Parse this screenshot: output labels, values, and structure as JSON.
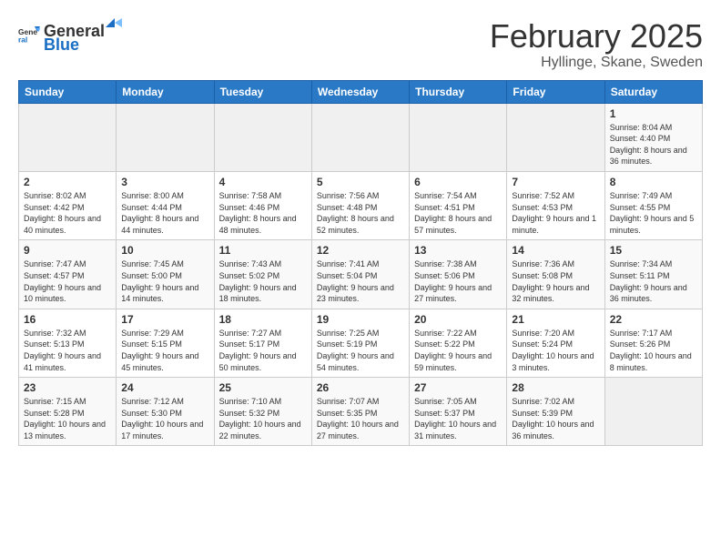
{
  "header": {
    "logo_general": "General",
    "logo_blue": "Blue",
    "month_title": "February 2025",
    "location": "Hyllinge, Skane, Sweden"
  },
  "weekdays": [
    "Sunday",
    "Monday",
    "Tuesday",
    "Wednesday",
    "Thursday",
    "Friday",
    "Saturday"
  ],
  "weeks": [
    [
      {
        "day": "",
        "info": ""
      },
      {
        "day": "",
        "info": ""
      },
      {
        "day": "",
        "info": ""
      },
      {
        "day": "",
        "info": ""
      },
      {
        "day": "",
        "info": ""
      },
      {
        "day": "",
        "info": ""
      },
      {
        "day": "1",
        "info": "Sunrise: 8:04 AM\nSunset: 4:40 PM\nDaylight: 8 hours and 36 minutes."
      }
    ],
    [
      {
        "day": "2",
        "info": "Sunrise: 8:02 AM\nSunset: 4:42 PM\nDaylight: 8 hours and 40 minutes."
      },
      {
        "day": "3",
        "info": "Sunrise: 8:00 AM\nSunset: 4:44 PM\nDaylight: 8 hours and 44 minutes."
      },
      {
        "day": "4",
        "info": "Sunrise: 7:58 AM\nSunset: 4:46 PM\nDaylight: 8 hours and 48 minutes."
      },
      {
        "day": "5",
        "info": "Sunrise: 7:56 AM\nSunset: 4:48 PM\nDaylight: 8 hours and 52 minutes."
      },
      {
        "day": "6",
        "info": "Sunrise: 7:54 AM\nSunset: 4:51 PM\nDaylight: 8 hours and 57 minutes."
      },
      {
        "day": "7",
        "info": "Sunrise: 7:52 AM\nSunset: 4:53 PM\nDaylight: 9 hours and 1 minute."
      },
      {
        "day": "8",
        "info": "Sunrise: 7:49 AM\nSunset: 4:55 PM\nDaylight: 9 hours and 5 minutes."
      }
    ],
    [
      {
        "day": "9",
        "info": "Sunrise: 7:47 AM\nSunset: 4:57 PM\nDaylight: 9 hours and 10 minutes."
      },
      {
        "day": "10",
        "info": "Sunrise: 7:45 AM\nSunset: 5:00 PM\nDaylight: 9 hours and 14 minutes."
      },
      {
        "day": "11",
        "info": "Sunrise: 7:43 AM\nSunset: 5:02 PM\nDaylight: 9 hours and 18 minutes."
      },
      {
        "day": "12",
        "info": "Sunrise: 7:41 AM\nSunset: 5:04 PM\nDaylight: 9 hours and 23 minutes."
      },
      {
        "day": "13",
        "info": "Sunrise: 7:38 AM\nSunset: 5:06 PM\nDaylight: 9 hours and 27 minutes."
      },
      {
        "day": "14",
        "info": "Sunrise: 7:36 AM\nSunset: 5:08 PM\nDaylight: 9 hours and 32 minutes."
      },
      {
        "day": "15",
        "info": "Sunrise: 7:34 AM\nSunset: 5:11 PM\nDaylight: 9 hours and 36 minutes."
      }
    ],
    [
      {
        "day": "16",
        "info": "Sunrise: 7:32 AM\nSunset: 5:13 PM\nDaylight: 9 hours and 41 minutes."
      },
      {
        "day": "17",
        "info": "Sunrise: 7:29 AM\nSunset: 5:15 PM\nDaylight: 9 hours and 45 minutes."
      },
      {
        "day": "18",
        "info": "Sunrise: 7:27 AM\nSunset: 5:17 PM\nDaylight: 9 hours and 50 minutes."
      },
      {
        "day": "19",
        "info": "Sunrise: 7:25 AM\nSunset: 5:19 PM\nDaylight: 9 hours and 54 minutes."
      },
      {
        "day": "20",
        "info": "Sunrise: 7:22 AM\nSunset: 5:22 PM\nDaylight: 9 hours and 59 minutes."
      },
      {
        "day": "21",
        "info": "Sunrise: 7:20 AM\nSunset: 5:24 PM\nDaylight: 10 hours and 3 minutes."
      },
      {
        "day": "22",
        "info": "Sunrise: 7:17 AM\nSunset: 5:26 PM\nDaylight: 10 hours and 8 minutes."
      }
    ],
    [
      {
        "day": "23",
        "info": "Sunrise: 7:15 AM\nSunset: 5:28 PM\nDaylight: 10 hours and 13 minutes."
      },
      {
        "day": "24",
        "info": "Sunrise: 7:12 AM\nSunset: 5:30 PM\nDaylight: 10 hours and 17 minutes."
      },
      {
        "day": "25",
        "info": "Sunrise: 7:10 AM\nSunset: 5:32 PM\nDaylight: 10 hours and 22 minutes."
      },
      {
        "day": "26",
        "info": "Sunrise: 7:07 AM\nSunset: 5:35 PM\nDaylight: 10 hours and 27 minutes."
      },
      {
        "day": "27",
        "info": "Sunrise: 7:05 AM\nSunset: 5:37 PM\nDaylight: 10 hours and 31 minutes."
      },
      {
        "day": "28",
        "info": "Sunrise: 7:02 AM\nSunset: 5:39 PM\nDaylight: 10 hours and 36 minutes."
      },
      {
        "day": "",
        "info": ""
      }
    ]
  ]
}
